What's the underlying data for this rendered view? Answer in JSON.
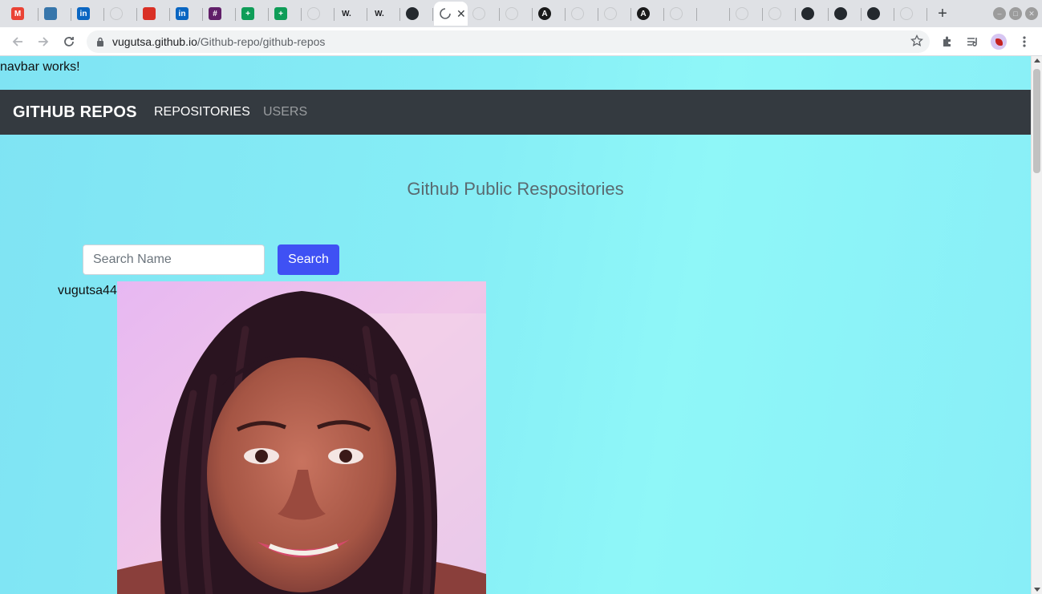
{
  "browser": {
    "url_host": "vugutsa.github.io",
    "url_path": "/Github-repo/github-repos",
    "tabs": [
      {
        "icon": "gmail-icon",
        "glyph": "M",
        "color": "#ea4335"
      },
      {
        "icon": "python-icon",
        "glyph": "",
        "color": "#3776ab"
      },
      {
        "icon": "linkedin-icon",
        "glyph": "in",
        "color": "#0a66c2"
      },
      {
        "icon": "blank-page-icon",
        "glyph": "",
        "color": "#c7c9cc"
      },
      {
        "icon": "app-red-icon",
        "glyph": "",
        "color": "#d93025"
      },
      {
        "icon": "linkedin-icon",
        "glyph": "in",
        "color": "#0a66c2"
      },
      {
        "icon": "slack-icon",
        "glyph": "#",
        "color": "#611f69"
      },
      {
        "icon": "sheets-icon",
        "glyph": "+",
        "color": "#0f9d58"
      },
      {
        "icon": "sheets-icon",
        "glyph": "+",
        "color": "#0f9d58"
      },
      {
        "icon": "blank-page-icon",
        "glyph": "",
        "color": "#c7c9cc"
      },
      {
        "icon": "wordpress-w-icon",
        "glyph": "W.",
        "color": "transparent"
      },
      {
        "icon": "wordpress-w-icon",
        "glyph": "W.",
        "color": "transparent"
      },
      {
        "icon": "github-icon",
        "glyph": "",
        "color": "#24292e"
      },
      {
        "icon": "loading-icon",
        "glyph": "",
        "color": "transparent"
      },
      {
        "icon": "blank-page-icon",
        "glyph": "",
        "color": "#c7c9cc"
      },
      {
        "icon": "blank-page-icon",
        "glyph": "",
        "color": "#c7c9cc"
      },
      {
        "icon": "angular-icon",
        "glyph": "A",
        "color": "#1a1a1a"
      },
      {
        "icon": "blank-page-icon",
        "glyph": "",
        "color": "#c7c9cc"
      },
      {
        "icon": "blank-page-icon",
        "glyph": "",
        "color": "#c7c9cc"
      },
      {
        "icon": "angular-icon",
        "glyph": "A",
        "color": "#1a1a1a"
      },
      {
        "icon": "blank-page-icon",
        "glyph": "",
        "color": "#c7c9cc"
      },
      {
        "icon": "audio-tab-icon",
        "glyph": "",
        "color": "transparent"
      },
      {
        "icon": "blank-page-icon",
        "glyph": "",
        "color": "#c7c9cc"
      },
      {
        "icon": "blank-page-icon",
        "glyph": "",
        "color": "#c7c9cc"
      },
      {
        "icon": "github-icon",
        "glyph": "",
        "color": "#24292e"
      },
      {
        "icon": "github-icon",
        "glyph": "",
        "color": "#24292e"
      },
      {
        "icon": "github-icon",
        "glyph": "",
        "color": "#24292e"
      },
      {
        "icon": "blank-page-icon",
        "glyph": "",
        "color": "#c7c9cc"
      }
    ]
  },
  "page": {
    "debug_text": "navbar works!",
    "navbar": {
      "brand": "GITHUB REPOS",
      "links": [
        {
          "label": "REPOSITORIES",
          "active": true
        },
        {
          "label": "USERS",
          "active": false
        }
      ]
    },
    "heading": "Github Public Respositories",
    "search": {
      "placeholder": "Search Name",
      "value": "",
      "button_label": "Search"
    },
    "user": {
      "username": "vugutsa44"
    }
  },
  "colors": {
    "navbar_bg": "#343a40",
    "search_button": "#3f51f4",
    "page_bg_cyan": "#86eef6"
  }
}
